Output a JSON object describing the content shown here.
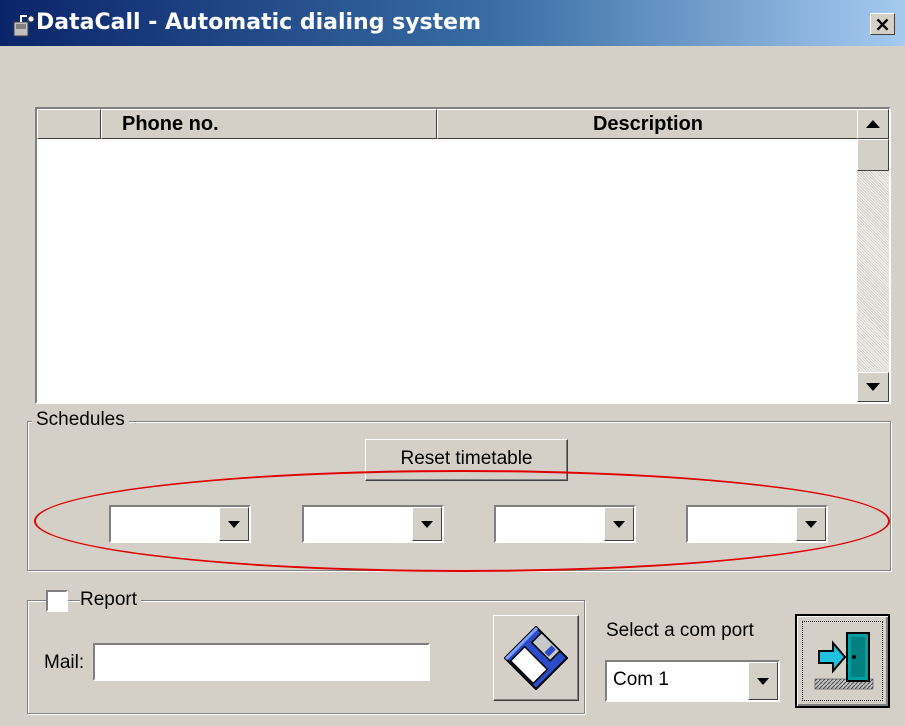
{
  "window": {
    "title": "DataCall - Automatic dialing system",
    "close_label": "×"
  },
  "grid": {
    "columns": [
      "",
      "Phone no.",
      "Description"
    ],
    "rows": []
  },
  "schedules": {
    "label": "Schedules",
    "reset_label": "Reset timetable",
    "combos": [
      "",
      "",
      "",
      ""
    ]
  },
  "report": {
    "checkbox_label": "Report",
    "checked": false,
    "mail_label": "Mail:",
    "mail_value": ""
  },
  "com": {
    "label": "Select a com port",
    "value": "Com 1"
  },
  "icons": {
    "app": "phone-icon",
    "save": "floppy-disk-icon",
    "exit": "exit-door-icon",
    "scroll_up": "scroll-up-arrow-icon",
    "scroll_down": "scroll-down-arrow-icon",
    "dropdown": "dropdown-arrow-icon"
  },
  "colors": {
    "title_start": "#0a246a",
    "title_end": "#a6caf0",
    "face": "#d4d0c8",
    "highlight_ellipse": "#e00000"
  }
}
